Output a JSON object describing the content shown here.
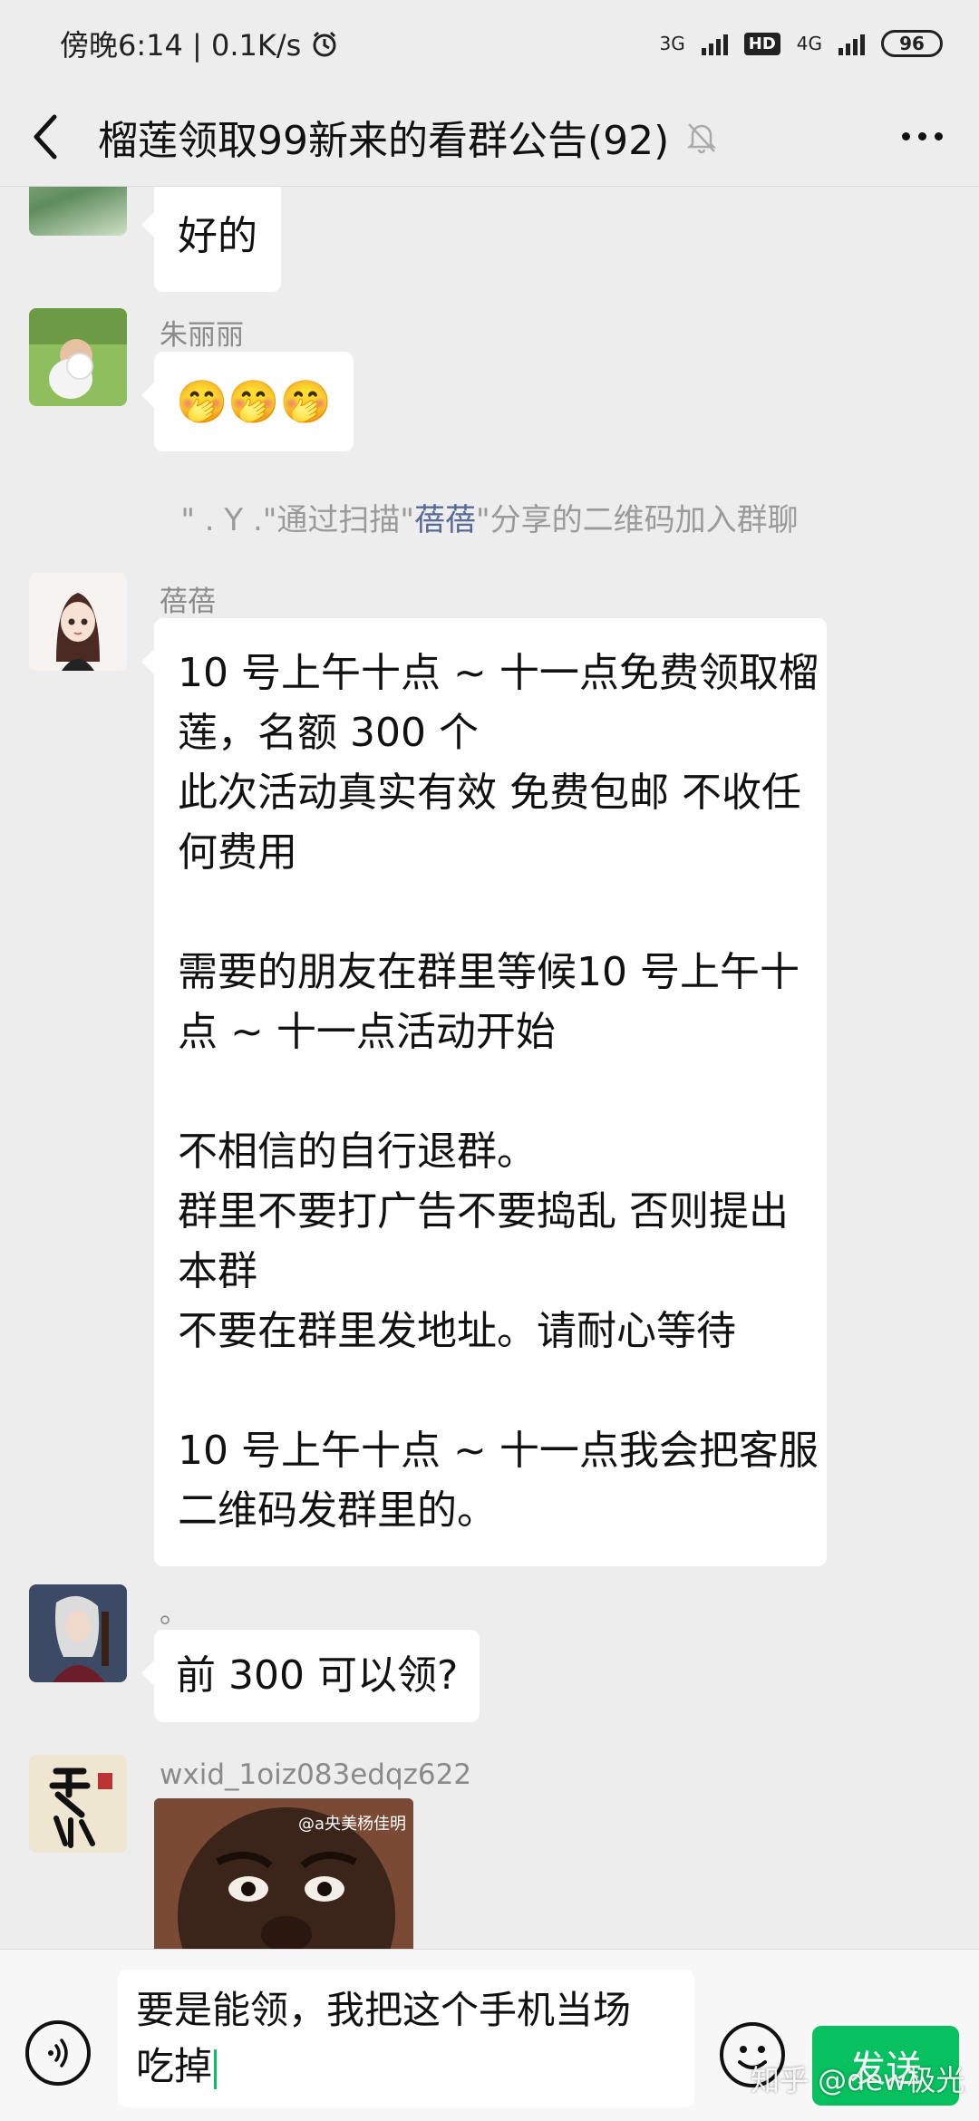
{
  "status_bar": {
    "time_text": "傍晚6:14 | 0.1K/s",
    "network_1": "3G",
    "hd_label": "HD",
    "network_2": "4G",
    "battery": "96"
  },
  "header": {
    "title": "榴莲领取99新来的看群公告(92)"
  },
  "messages": {
    "m1": {
      "text": "好的"
    },
    "m2": {
      "sender": "朱丽丽",
      "text": "🤭🤭🤭"
    },
    "system": {
      "part1": "\" . Y .\"通过扫描\"",
      "highlight": "蓓蓓",
      "part2": "\"分享的二维码加入群聊"
    },
    "m3": {
      "sender": "蓓蓓",
      "lines": [
        "10 号上午十点 ~ 十一点免费领取榴",
        "莲，名额 300 个",
        "此次活动真实有效 免费包邮 不收任",
        "何费用",
        "",
        "需要的朋友在群里等候10 号上午十",
        "点 ~ 十一点活动开始",
        "",
        "不相信的自行退群。",
        "群里不要打广告不要捣乱 否则提出",
        "本群",
        "不要在群里发地址。请耐心等待",
        "",
        "10 号上午十点 ~ 十一点我会把客服",
        "二维码发群里的。"
      ]
    },
    "m4": {
      "sender": "。",
      "text": "前 300 可以领?"
    },
    "m5": {
      "sender": "wxid_1oiz083edqz622",
      "image_watermark": "@a央美杨佳明"
    }
  },
  "input": {
    "line1": "要是能领，我把这个手机当场",
    "line2": "吃掉"
  },
  "send_label": "发送",
  "watermark": "知乎 @dew极光",
  "colors": {
    "accent": "#07c160",
    "link": "#576b95",
    "background": "#ededed"
  }
}
